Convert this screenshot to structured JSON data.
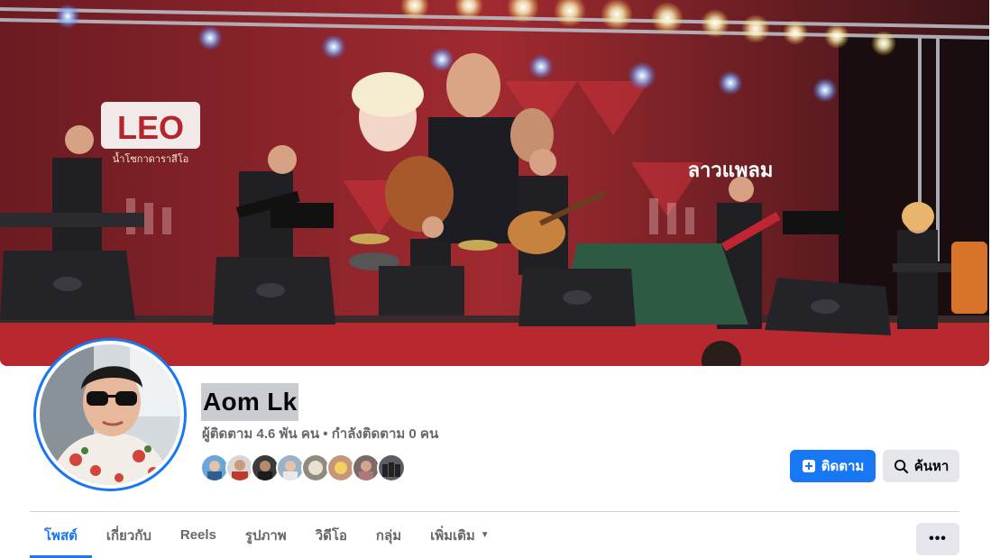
{
  "profile": {
    "name": "Aom Lk",
    "stats": "ผู้ติดตาม 4.6 พัน คน • กำลังติดตาม 0 คน"
  },
  "cover": {
    "banner_brand": "LEO",
    "banner_tagline": "น้ำโซกาดาราสีโอ",
    "banner_logo_text": "ลาวแพลม"
  },
  "actions": {
    "follow_label": "ติดตาม",
    "follow_icon": "add-friend-icon",
    "search_label": "ค้นหา",
    "search_icon": "search-icon",
    "more_label": "•••"
  },
  "tabs": [
    {
      "label": "โพสต์",
      "active": true
    },
    {
      "label": "เกี่ยวกับ",
      "active": false
    },
    {
      "label": "Reels",
      "active": false
    },
    {
      "label": "รูปภาพ",
      "active": false
    },
    {
      "label": "วิดีโอ",
      "active": false
    },
    {
      "label": "กลุ่ม",
      "active": false
    },
    {
      "label": "เพิ่มเติม",
      "active": false
    }
  ],
  "colors": {
    "accent": "#1877f2",
    "secondary_button": "#e4e6eb",
    "muted_text": "#65676b"
  }
}
